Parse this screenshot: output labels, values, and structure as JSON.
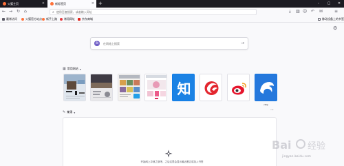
{
  "tabs": [
    {
      "label": "火狐主页",
      "favicon_color": "#ff7139",
      "active": false
    },
    {
      "label": "新标签页",
      "favicon_color": "#ff7139",
      "active": true
    }
  ],
  "new_tab_symbol": "+",
  "window_controls": [
    "–",
    "▢",
    "✕"
  ],
  "navbar": {
    "back_icon": "←",
    "forward_icon": "→",
    "reload_icon": "↻",
    "home_icon": "⌂",
    "url_placeholder": "使用百度搜索，或者输入网址",
    "right_icons": [
      "⤓",
      "▥",
      "☺",
      "↶",
      "✉",
      "≡"
    ]
  },
  "bookmarks": {
    "items": [
      {
        "label": "最常访问",
        "icon_color": "#5b5b66"
      },
      {
        "label": "火狐官方站点",
        "icon_color": "#ff7139"
      },
      {
        "label": "新手上路",
        "icon_color": "#ff7139"
      },
      {
        "label": "常用网址",
        "icon_color": "#e5393e"
      },
      {
        "label": "京东商城",
        "icon_color": "#e1251b"
      }
    ],
    "mobile_label": "移动设备上的书签"
  },
  "search": {
    "placeholder": "在网络上搜索",
    "engine_letter": "百"
  },
  "top_sites": {
    "heading": "常用网站",
    "tiles": [
      {
        "label": "",
        "theme": "photo"
      },
      {
        "label": "",
        "theme": "dark-photo"
      },
      {
        "label": "",
        "theme": "collage"
      },
      {
        "label": "",
        "theme": "pink"
      },
      {
        "label": "",
        "theme": "zhihu",
        "letter": "知"
      },
      {
        "label": "",
        "theme": "red-swirl"
      },
      {
        "label": "",
        "theme": "weibo"
      },
      {
        "label": "ctrip",
        "theme": "ctrip"
      }
    ]
  },
  "highlights": {
    "heading": "集锦",
    "empty_message": "开始网上冲浪之旅吧，之后这里会显示最近看过或加入书签"
  },
  "watermark": {
    "brand": "Bai",
    "brand2": "经验",
    "url": "jingyan.baidu.com"
  },
  "colors": {
    "accent": "#0061e0",
    "tabbar_bg": "#1c1b22",
    "page_bg": "#f9f9fb"
  }
}
